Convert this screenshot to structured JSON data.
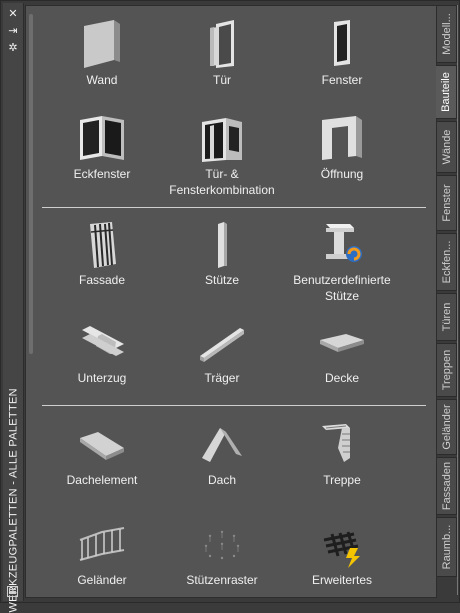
{
  "palette": {
    "title": "WERKZEUGPALETTEN - ALLE PALETTEN",
    "controls": {
      "close": "✕",
      "autohide": "⇥",
      "properties": "✲"
    }
  },
  "tabs": [
    {
      "label": "Modell..."
    },
    {
      "label": "Bauteile"
    },
    {
      "label": "Wände"
    },
    {
      "label": "Fenster"
    },
    {
      "label": "Eckfen..."
    },
    {
      "label": "Türen"
    },
    {
      "label": "Treppen"
    },
    {
      "label": "Geländer"
    },
    {
      "label": "Fassaden"
    },
    {
      "label": "Raumb..."
    }
  ],
  "tools": [
    {
      "label": "Wand",
      "icon": "wall-icon"
    },
    {
      "label": "Tür",
      "icon": "door-icon"
    },
    {
      "label": "Fenster",
      "icon": "window-icon"
    },
    {
      "label": "Eckfenster",
      "icon": "corner-window-icon"
    },
    {
      "label": "Tür- & Fensterkombination",
      "icon": "door-window-assembly-icon"
    },
    {
      "label": "Öffnung",
      "icon": "opening-icon"
    },
    {
      "label": "Fassade",
      "icon": "curtain-wall-icon"
    },
    {
      "label": "Stütze",
      "icon": "column-icon"
    },
    {
      "label": "Benutzerdefinierte Stütze",
      "icon": "custom-column-icon"
    },
    {
      "label": "Unterzug",
      "icon": "beam-icon"
    },
    {
      "label": "Träger",
      "icon": "brace-icon"
    },
    {
      "label": "Decke",
      "icon": "slab-icon"
    },
    {
      "label": "Dachelement",
      "icon": "roof-slab-icon"
    },
    {
      "label": "Dach",
      "icon": "roof-icon"
    },
    {
      "label": "Treppe",
      "icon": "stair-icon"
    },
    {
      "label": "Geländer",
      "icon": "railing-icon"
    },
    {
      "label": "Stützenraster",
      "icon": "column-grid-icon"
    },
    {
      "label": "Erweitertes",
      "icon": "advanced-icon"
    }
  ],
  "colors": {
    "panel": "#545454",
    "frame": "#3b3b3b",
    "text": "#f0f0f0",
    "separator": "#cfcfcf"
  }
}
